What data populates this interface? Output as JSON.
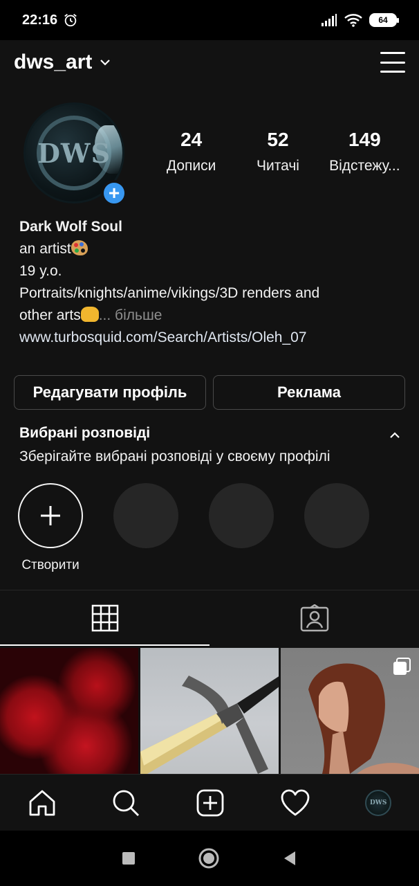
{
  "status_bar": {
    "time": "22:16",
    "battery": "64",
    "icons": [
      "alarm-icon",
      "signal-icon",
      "wifi-icon",
      "battery-icon"
    ]
  },
  "header": {
    "username": "dws_art",
    "icons": [
      "chevron-down-icon",
      "hamburger-menu-icon"
    ]
  },
  "profile": {
    "avatar_text": "DWS",
    "stats": [
      {
        "value": "24",
        "label": "Дописи"
      },
      {
        "value": "52",
        "label": "Читачі"
      },
      {
        "value": "149",
        "label": "Відстежу..."
      }
    ],
    "name": "Dark Wolf Soul",
    "bio_line1": "an artist",
    "bio_line2": "19 y.o.",
    "bio_line3": "Portraits/knights/anime/vikings/3D renders and",
    "bio_line4": "other arts",
    "more": "... більше",
    "website": "www.turbosquid.com/Search/Artists/Oleh_07"
  },
  "buttons": {
    "edit_profile": "Редагувати профіль",
    "promotions": "Реклама"
  },
  "highlights": {
    "title": "Вибрані розповіді",
    "subtitle": "Зберігайте вибрані розповіді у своєму профілі",
    "new_label": "Створити"
  },
  "tabs": [
    "grid-icon",
    "tagged-icon"
  ],
  "posts": [
    "roses",
    "sword",
    "girl-portrait"
  ],
  "bottom_nav": {
    "items": [
      "home-icon",
      "search-icon",
      "new-post-icon",
      "activity-heart-icon",
      "profile-avatar"
    ],
    "avatar_text": "DWS"
  },
  "system_nav": [
    "recents-square-icon",
    "home-circle-icon",
    "back-triangle-icon"
  ],
  "colors": {
    "background": "#121212",
    "accent_blue": "#3897f0",
    "muted_text": "#8e8e8e"
  }
}
